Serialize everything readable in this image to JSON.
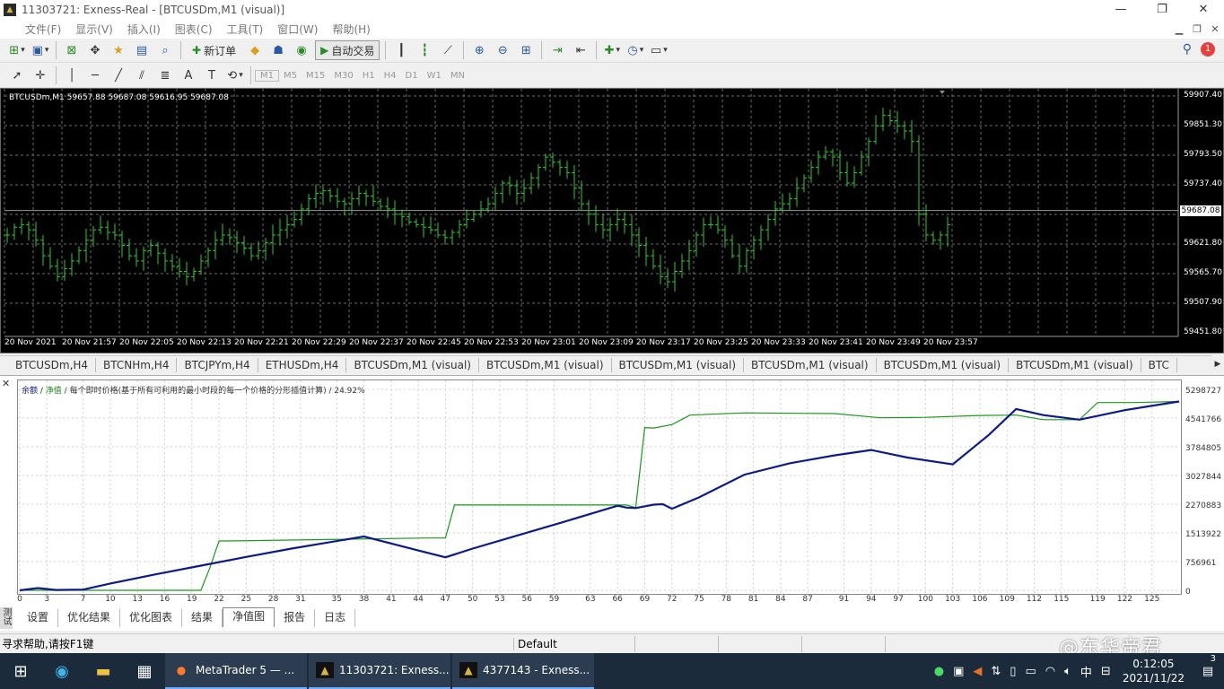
{
  "window": {
    "title": "11303721: Exness-Real - [BTCUSDm,M1 (visual)]",
    "minimize": "—",
    "restore": "❐",
    "close": "✕"
  },
  "menu": [
    "文件(F)",
    "显示(V)",
    "插入(I)",
    "图表(C)",
    "工具(T)",
    "窗口(W)",
    "帮助(H)"
  ],
  "toolbar": {
    "new_order": "新订单",
    "autotrade": "自动交易",
    "notification_count": "1"
  },
  "timeframes": [
    "M1",
    "M5",
    "M15",
    "M30",
    "H1",
    "H4",
    "D1",
    "W1",
    "MN"
  ],
  "chart": {
    "info": "BTCUSDm,M1  59657.88 59687.08 59616.95 59687.08",
    "current_price": "59687.08",
    "price_labels": [
      "59907.40",
      "59851.30",
      "59793.50",
      "59737.40",
      "59621.80",
      "59565.70",
      "59507.90",
      "59451.80"
    ],
    "time_labels": [
      "20 Nov 2021",
      "20 Nov 21:57",
      "20 Nov 22:05",
      "20 Nov 22:13",
      "20 Nov 22:21",
      "20 Nov 22:29",
      "20 Nov 22:37",
      "20 Nov 22:45",
      "20 Nov 22:53",
      "20 Nov 23:01",
      "20 Nov 23:09",
      "20 Nov 23:17",
      "20 Nov 23:25",
      "20 Nov 23:33",
      "20 Nov 23:41",
      "20 Nov 23:49",
      "20 Nov 23:57"
    ],
    "y_range": [
      59451.8,
      59907.4
    ],
    "bar_color": "#2ecc2e",
    "bar_closes": [
      59640,
      59655,
      59660,
      59650,
      59630,
      59600,
      59580,
      59560,
      59575,
      59590,
      59610,
      59630,
      59650,
      59655,
      59645,
      59640,
      59620,
      59600,
      59590,
      59610,
      59620,
      59605,
      59590,
      59580,
      59570,
      59560,
      59570,
      59590,
      59610,
      59630,
      59640,
      59635,
      59625,
      59615,
      59600,
      59610,
      59625,
      59640,
      59650,
      59660,
      59670,
      59690,
      59710,
      59720,
      59725,
      59715,
      59705,
      59700,
      59710,
      59720,
      59715,
      59705,
      59695,
      59690,
      59680,
      59675,
      59665,
      59660,
      59655,
      59650,
      59640,
      59635,
      59645,
      59660,
      59670,
      59680,
      59690,
      59700,
      59720,
      59740,
      59735,
      59720,
      59730,
      59750,
      59770,
      59790,
      59780,
      59770,
      59760,
      59730,
      59700,
      59680,
      59660,
      59650,
      59660,
      59670,
      59660,
      59640,
      59620,
      59600,
      59580,
      59560,
      59550,
      59570,
      59590,
      59610,
      59640,
      59660,
      59660,
      59650,
      59630,
      59600,
      59580,
      59610,
      59630,
      59650,
      59670,
      59690,
      59700,
      59710,
      59730,
      59750,
      59770,
      59790,
      59800,
      59790,
      59760,
      59740,
      59760,
      59790,
      59820,
      59850,
      59870,
      59860,
      59850,
      59840,
      59820,
      59680,
      59640,
      59630,
      59640,
      59660
    ]
  },
  "chart_tabs": [
    "BTCUSDm,H4",
    "BTCNHm,H4",
    "BTCJPYm,H4",
    "ETHUSDm,H4",
    "BTCUSDm,M1 (visual)",
    "BTCUSDm,M1 (visual)",
    "BTCUSDm,M1 (visual)",
    "BTCUSDm,M1 (visual)",
    "BTCUSDm,M1 (visual)",
    "BTCUSDm,M1 (visual)",
    "BTC"
  ],
  "tester": {
    "legend_balance": "余额",
    "legend_equity": "净值",
    "legend_rest": "/ 每个即时价格(基于所有可利用的最小时段的每一个价格的分形插值计算) / 24.92%",
    "side_label": "测试",
    "y_labels": [
      "5298727",
      "4541766",
      "3784805",
      "3027844",
      "2270883",
      "1513922",
      "756961",
      "0"
    ],
    "x_labels": [
      "0",
      "3",
      "7",
      "10",
      "13",
      "16",
      "19",
      "22",
      "25",
      "28",
      "31",
      "35",
      "38",
      "41",
      "44",
      "47",
      "50",
      "53",
      "56",
      "59",
      "63",
      "66",
      "69",
      "72",
      "75",
      "78",
      "81",
      "84",
      "87",
      "91",
      "94",
      "97",
      "100",
      "103",
      "106",
      "109",
      "112",
      "115",
      "119",
      "122",
      "125"
    ],
    "tabs": [
      "设置",
      "优化结果",
      "优化图表",
      "结果",
      "净值图",
      "报告",
      "日志"
    ],
    "active_tab": "净值图",
    "balance_color": "#0d1a8a",
    "equity_color": "#1a9a1a"
  },
  "chart_data": {
    "type": "line",
    "ylim": [
      0,
      5298727
    ],
    "series": [
      {
        "name": "余额",
        "x": [
          0,
          2,
          4,
          7,
          10,
          15,
          20,
          25,
          30,
          38,
          44,
          47,
          50,
          55,
          60,
          66,
          67,
          68,
          70,
          71,
          72,
          75,
          80,
          85,
          90,
          94,
          98,
          103,
          107,
          110,
          113,
          117,
          122,
          128
        ],
        "values": [
          0,
          60000,
          10000,
          20000,
          180000,
          420000,
          650000,
          880000,
          1100000,
          1420000,
          1050000,
          870000,
          1100000,
          1450000,
          1800000,
          2230000,
          2180000,
          2170000,
          2260000,
          2270000,
          2150000,
          2450000,
          3050000,
          3350000,
          3560000,
          3700000,
          3500000,
          3320000,
          4100000,
          4780000,
          4620000,
          4500000,
          4750000,
          4980000
        ]
      },
      {
        "name": "净值",
        "x": [
          0,
          20,
          21,
          22,
          23,
          45,
          47,
          48,
          67,
          68,
          69,
          70,
          72,
          74,
          80,
          90,
          95,
          100,
          106,
          110,
          113,
          115,
          117,
          119,
          123,
          128
        ],
        "values": [
          0,
          0,
          600000,
          1300000,
          1300000,
          1380000,
          1380000,
          2250000,
          2250000,
          2180000,
          4290000,
          4280000,
          4370000,
          4620000,
          4680000,
          4660000,
          4550000,
          4560000,
          4610000,
          4620000,
          4500000,
          4500000,
          4500000,
          4950000,
          4950000,
          4980000
        ]
      }
    ]
  },
  "statusbar": {
    "help": "寻求帮助,请按F1键",
    "profile": "Default",
    "watermark": "@东华帝君"
  },
  "taskbar": {
    "apps": [
      "MetaTrader 5 — ...",
      "11303721: Exness...",
      "4377143 - Exness..."
    ],
    "ime": "中",
    "time": "0:12:05",
    "date": "2021/11/22",
    "notifications": "3"
  }
}
